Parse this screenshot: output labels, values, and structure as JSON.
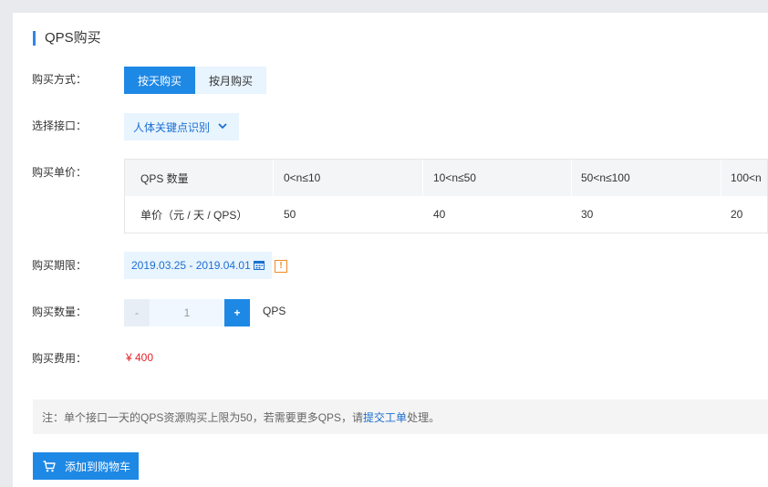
{
  "title": "QPS购买",
  "purchase_mode": {
    "label": "购买方式：",
    "options": [
      "按天购买",
      "按月购买"
    ],
    "selected": "按天购买"
  },
  "interface": {
    "label": "选择接口：",
    "selected": "人体关键点识别",
    "icon": "chevron-down-icon"
  },
  "unit_price": {
    "label": "购买单价：",
    "header": [
      "QPS 数量",
      "0<n≤10",
      "10<n≤50",
      "50<n≤100",
      "100<n"
    ],
    "row": [
      "单价（元 / 天 / QPS）",
      "50",
      "40",
      "30",
      "20"
    ]
  },
  "period": {
    "label": "购买期限：",
    "value": "2019.03.25 - 2019.04.01",
    "icons": [
      "calendar-icon",
      "warning-icon"
    ],
    "warning_glyph": "!"
  },
  "quantity": {
    "label": "购买数量：",
    "minus": "-",
    "value": "1",
    "plus": "+",
    "unit": "QPS"
  },
  "fee": {
    "label": "购买费用：",
    "value": "¥ 400"
  },
  "note": {
    "prefix": "注：单个接口一天的QPS资源购买上限为50，若需要更多QPS，请",
    "link": "提交工单",
    "suffix": "处理。"
  },
  "cart_button": {
    "label": "添加到购物车",
    "icon": "cart-icon"
  },
  "colors": {
    "accent": "#1e88e5",
    "light_accent": "#e8f4fe",
    "price": "#e3242b",
    "warning": "#f08a24"
  }
}
